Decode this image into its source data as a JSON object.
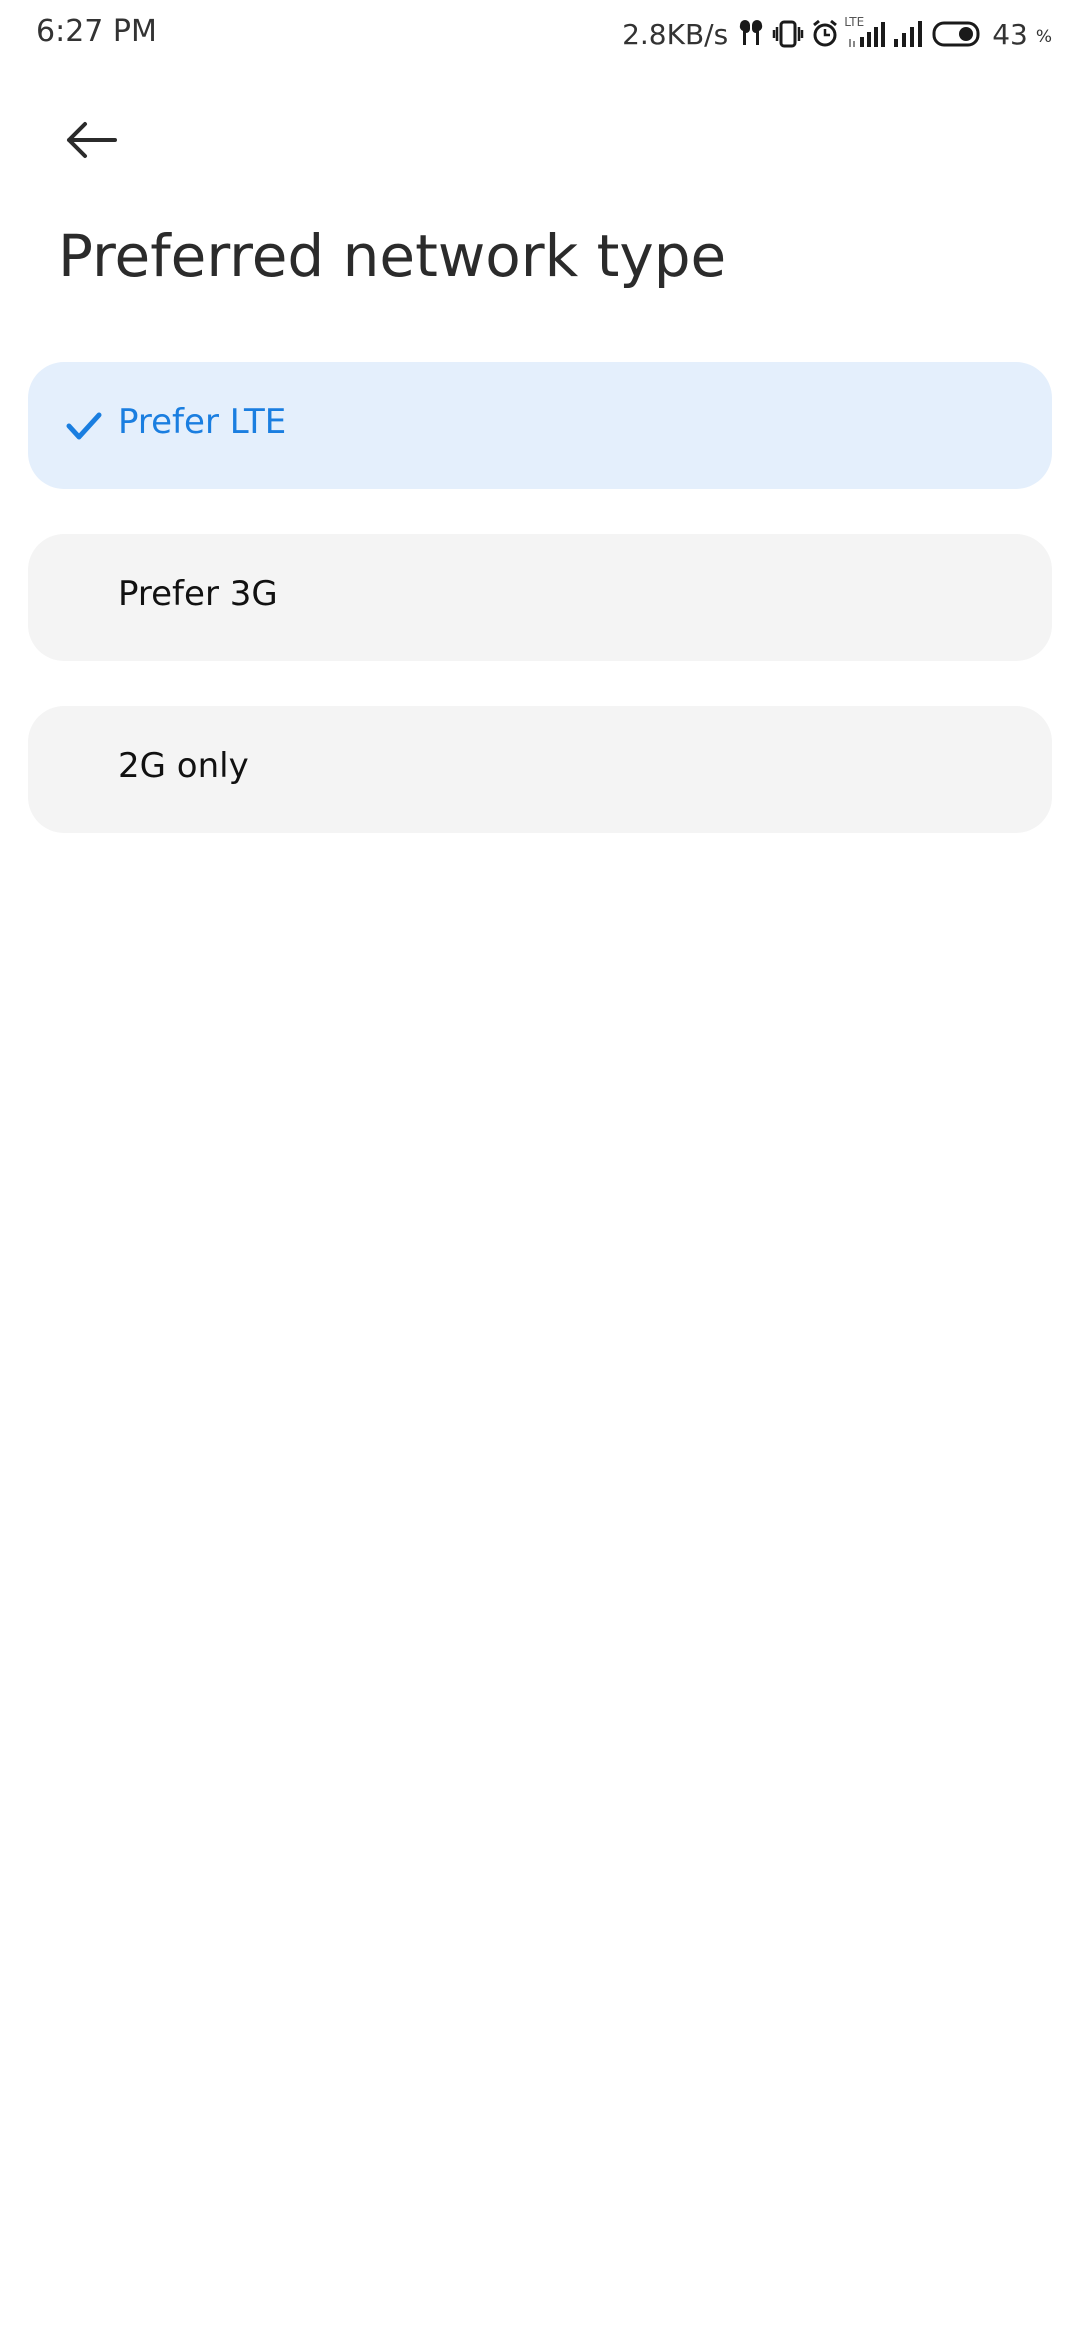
{
  "status_bar": {
    "time": "6:27 PM",
    "network_speed": "2.8KB/s",
    "icons": [
      "earbuds-icon",
      "vibrate-icon",
      "alarm-icon",
      "lte-signal-icon",
      "signal-icon",
      "battery-icon"
    ],
    "lte_text": "LTE",
    "battery_percent": "43",
    "battery_percent_sign": "%"
  },
  "header": {
    "back_icon": "back-arrow-icon",
    "title": "Preferred network type"
  },
  "options": [
    {
      "label": "Prefer LTE",
      "selected": true
    },
    {
      "label": "Prefer 3G",
      "selected": false
    },
    {
      "label": "2G only",
      "selected": false
    }
  ],
  "colors": {
    "accent": "#1a7ee0",
    "selected_background": "#e4effc",
    "option_background": "#f4f4f4",
    "title_text": "#2b2b2b"
  }
}
